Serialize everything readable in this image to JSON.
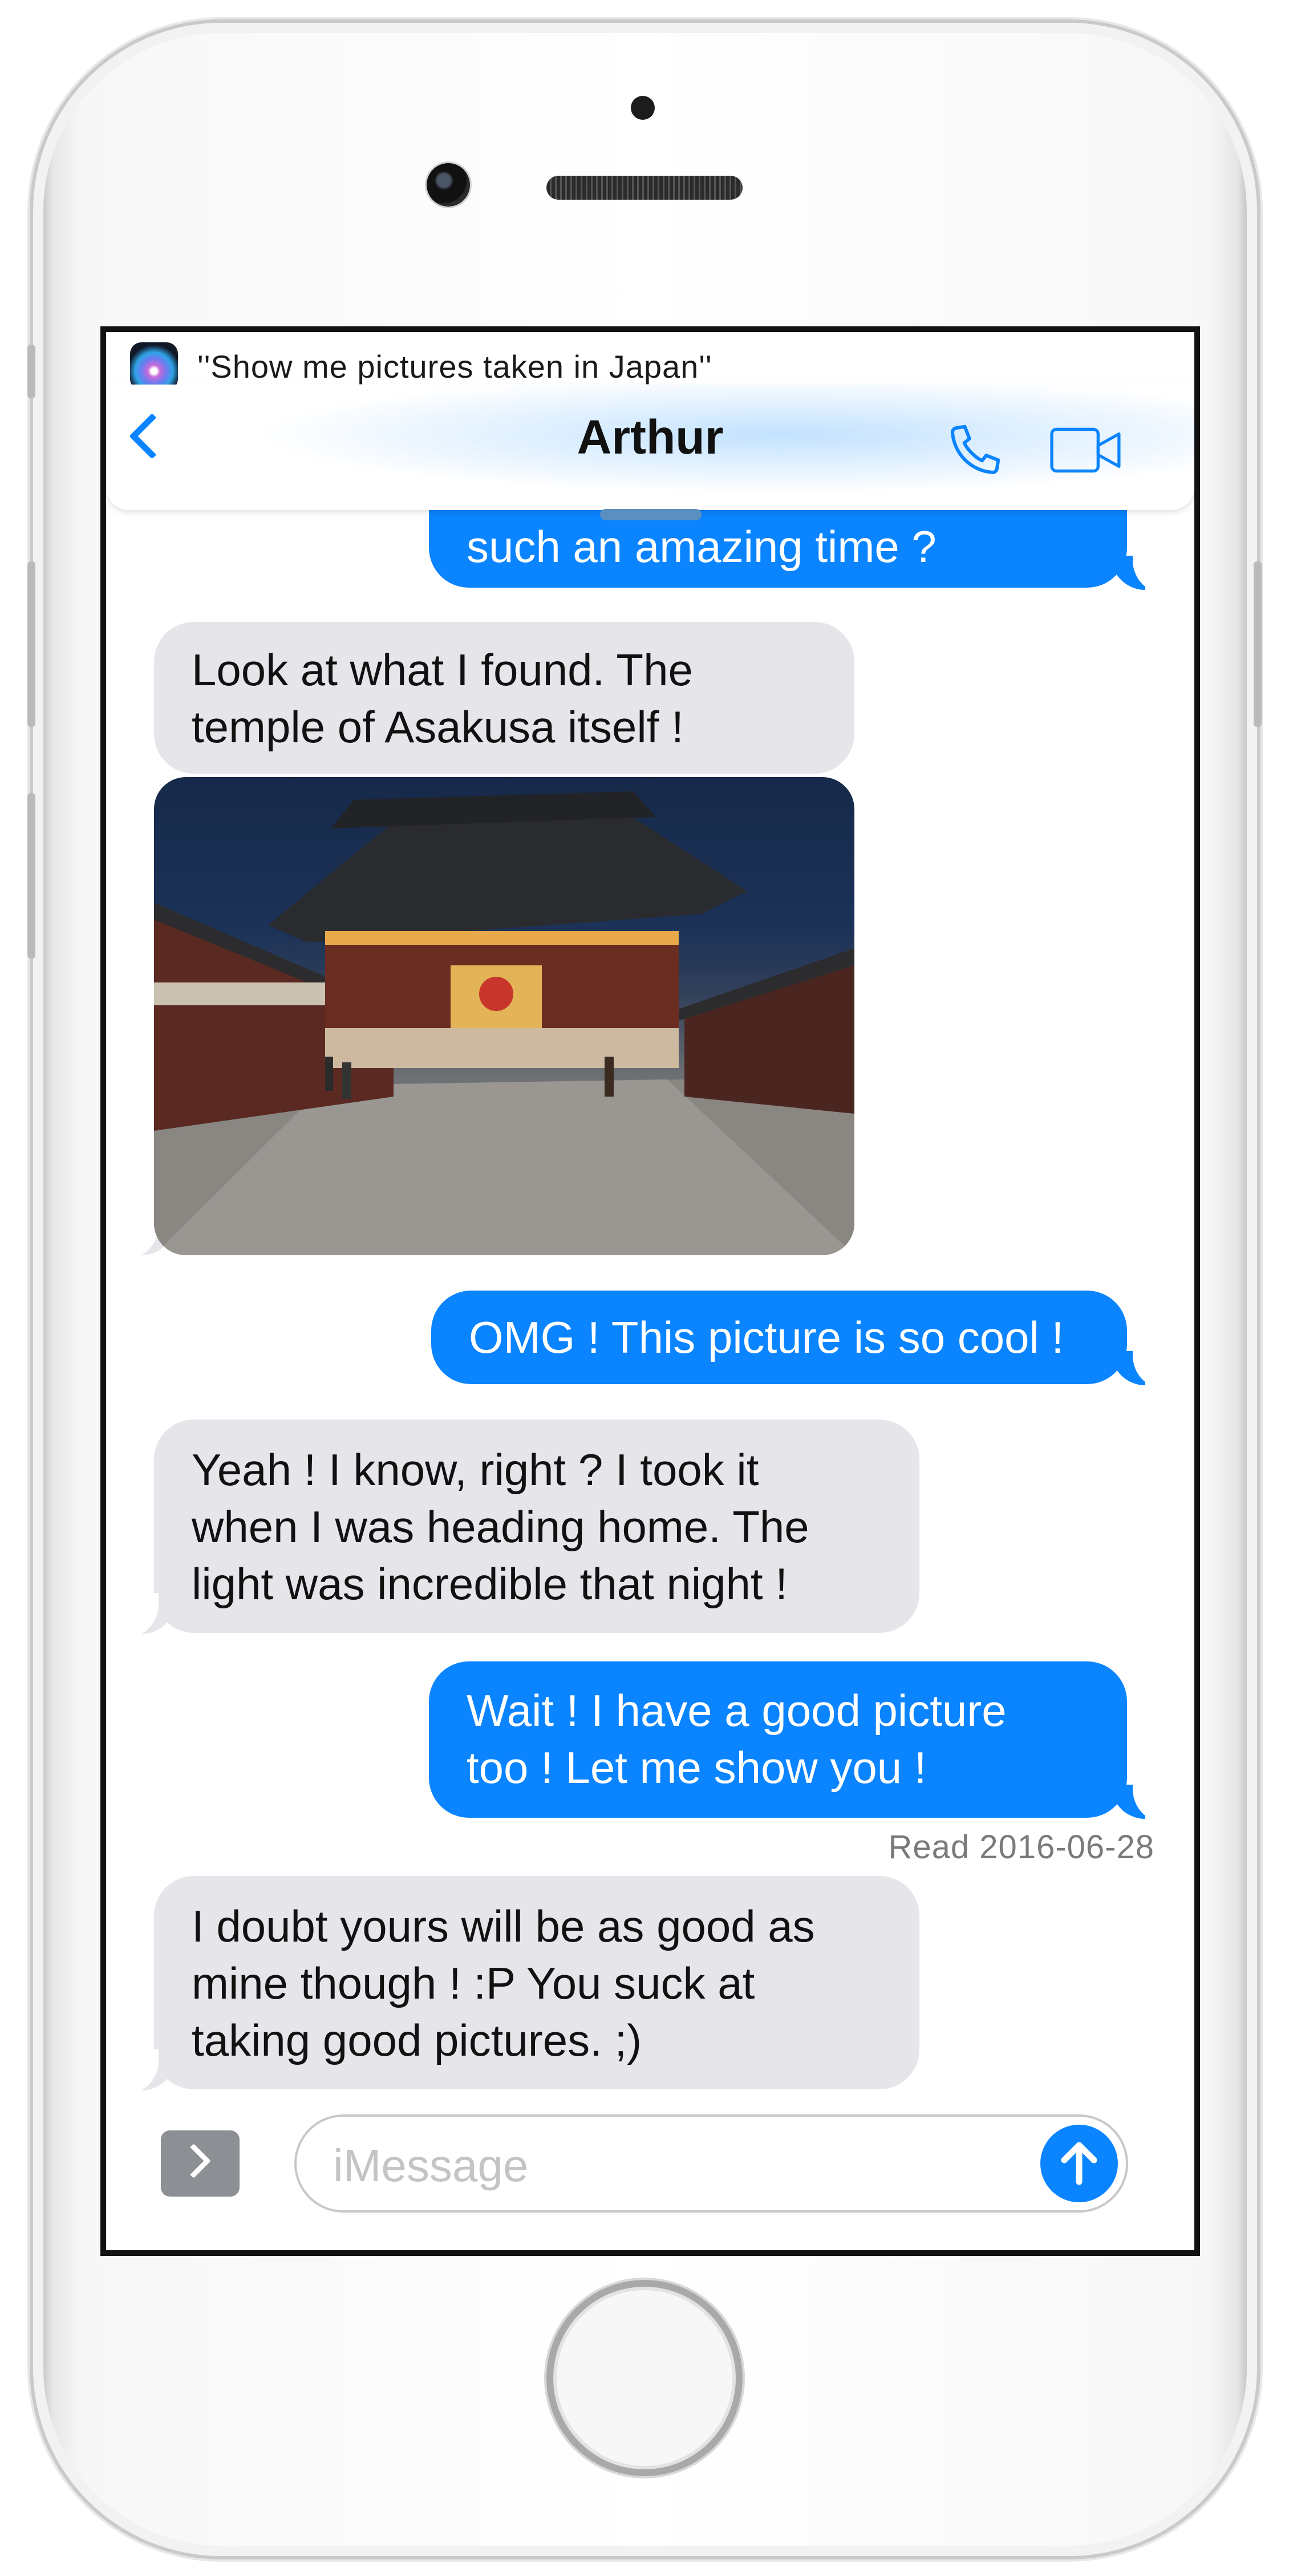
{
  "siri": {
    "query": "''Show me pictures taken in Japan''"
  },
  "header": {
    "contact_name": "Arthur"
  },
  "messages": [
    {
      "direction": "outgoing",
      "text": "such an amazing time ?"
    },
    {
      "direction": "incoming",
      "lines": [
        "Look at what I found. The",
        "temple of Asakusa itself !"
      ]
    },
    {
      "direction": "incoming",
      "type": "photo"
    },
    {
      "direction": "outgoing",
      "text": "OMG ! This picture is so cool !"
    },
    {
      "direction": "incoming",
      "lines": [
        "Yeah ! I know, right ? I took it",
        "when I was heading home. The",
        "light was incredible that night !"
      ]
    },
    {
      "direction": "outgoing",
      "lines": [
        "Wait ! I have a good picture",
        "too ! Let me show you !"
      ]
    },
    {
      "direction": "incoming",
      "lines": [
        "I doubt yours will be as good as",
        "mine though ! :P You suck at",
        "taking good pictures. ;)"
      ]
    }
  ],
  "read_receipt": "Read 2016-06-28",
  "composer": {
    "placeholder": "iMessage"
  },
  "colors": {
    "outgoing": "#0a84ff",
    "incoming": "#e5e5ea",
    "accent": "#0a84ff"
  }
}
